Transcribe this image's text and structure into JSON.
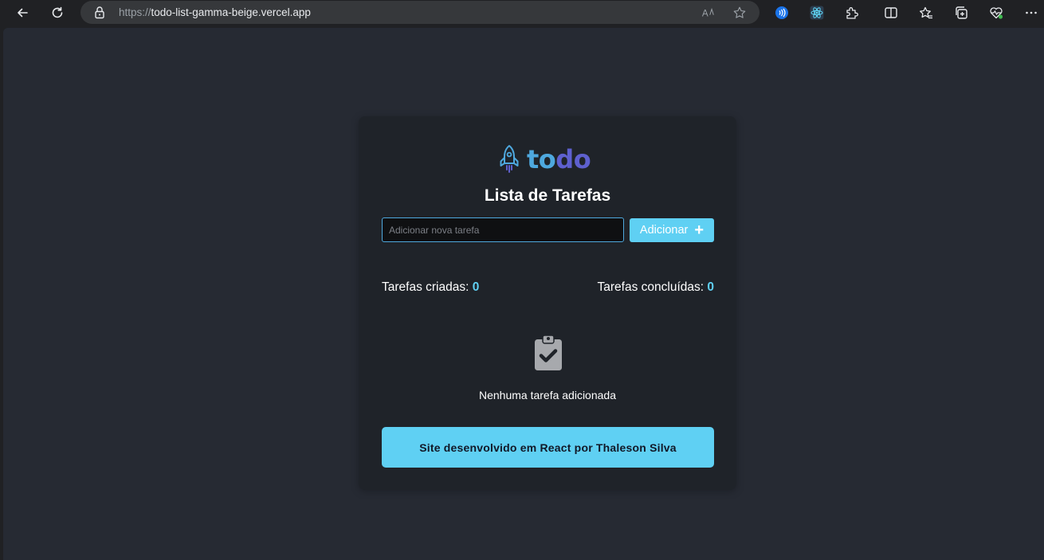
{
  "browser": {
    "url_protocol": "https://",
    "url_host": "todo-list-gamma-beige.vercel.app",
    "icons": [
      "back-icon",
      "refresh-icon",
      "lock-icon",
      "read-aloud-icon",
      "favorite-star-icon",
      "extension-blue-icon",
      "react-devtools-icon",
      "extensions-puzzle-icon",
      "split-screen-icon",
      "favorites-icon",
      "collections-icon",
      "browser-essentials-icon",
      "more-icon"
    ]
  },
  "app": {
    "logo_part1": "to",
    "logo_part2": "do",
    "title": "Lista de Tarefas",
    "input_placeholder": "Adicionar nova tarefa",
    "input_value": "",
    "add_button_label": "Adicionar",
    "created_label": "Tarefas criadas:",
    "created_count": "0",
    "completed_label": "Tarefas concluídas:",
    "completed_count": "0",
    "empty_message": "Nenhuma tarefa adicionada",
    "footer_text": "Site desenvolvido em React por Thaleson Silva"
  },
  "colors": {
    "accent": "#5fd0f3",
    "logo_blue": "#4ea8de",
    "logo_purple": "#5e60ce",
    "card_bg": "#1f2329",
    "page_bg": "#262a33"
  }
}
